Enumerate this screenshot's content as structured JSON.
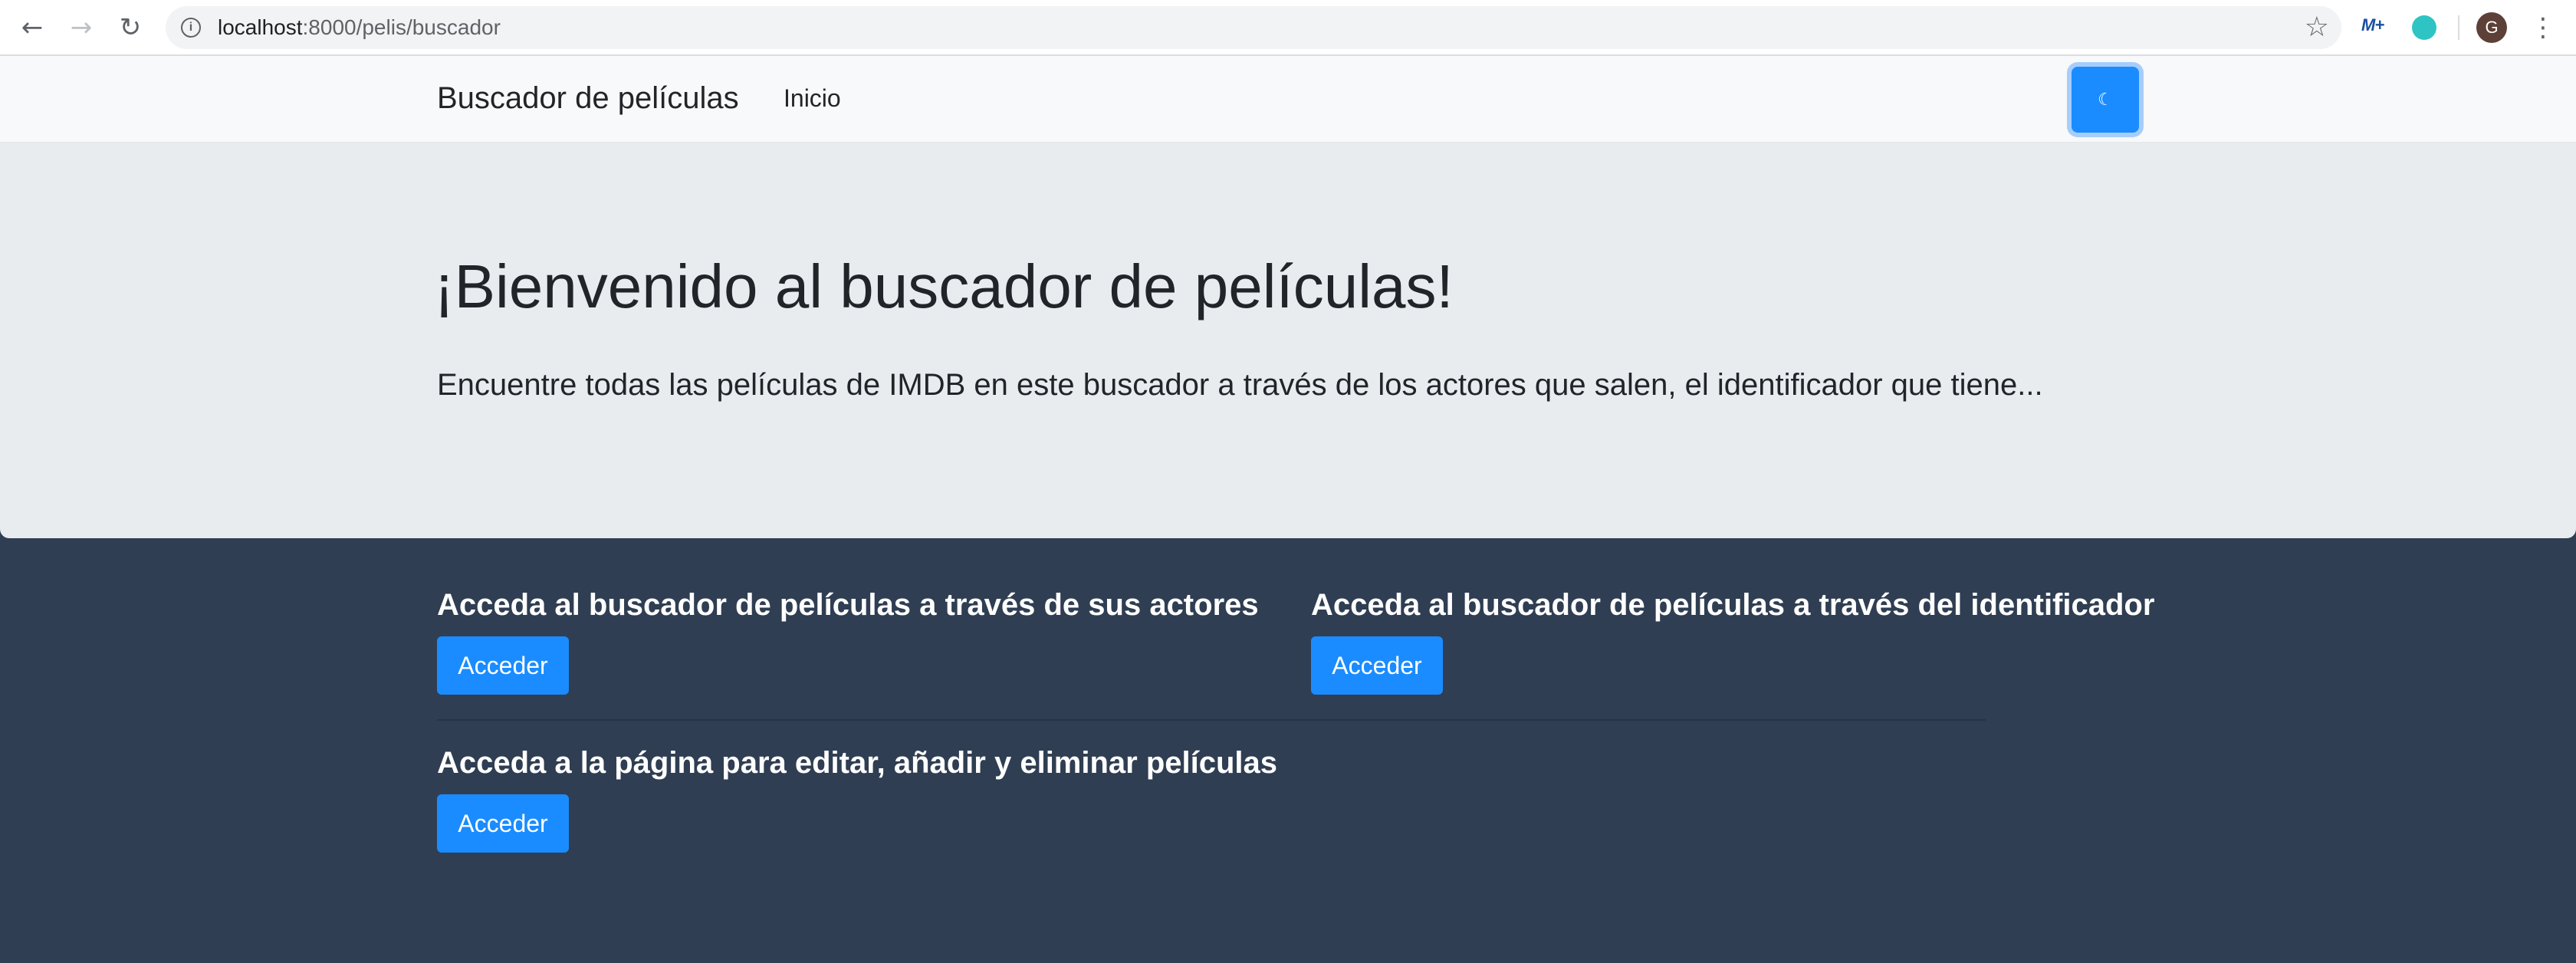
{
  "browser": {
    "url_host": "localhost",
    "url_path": ":8000/pelis/buscador",
    "icons": [
      "back-icon",
      "forward-icon",
      "reload-icon",
      "info-icon",
      "star-icon",
      "extension-icon",
      "menu-icon"
    ],
    "avatar_letter": "G",
    "extension_label": "M+"
  },
  "navbar": {
    "brand": "Buscador de películas",
    "links": [
      {
        "label": "Inicio"
      }
    ],
    "theme_toggle_icon": "moon-icon"
  },
  "hero": {
    "title": "¡Bienvenido al buscador de películas!",
    "subtitle": "Encuentre todas las películas de IMDB en este buscador a través de los actores que salen, el identificador que tiene..."
  },
  "sections": [
    {
      "title": "Acceda al buscador de películas a través de sus actores",
      "button": "Acceder"
    },
    {
      "title": "Acceda al buscador de películas a través del identificador",
      "button": "Acceder"
    },
    {
      "title": "Acceda a la página para editar, añadir y eliminar películas",
      "button": "Acceder"
    }
  ],
  "colors": {
    "page_background": "#2f3e52",
    "hero_background": "#e9ecef",
    "navbar_background": "#f8f9fa",
    "primary": "#1a8cff"
  }
}
